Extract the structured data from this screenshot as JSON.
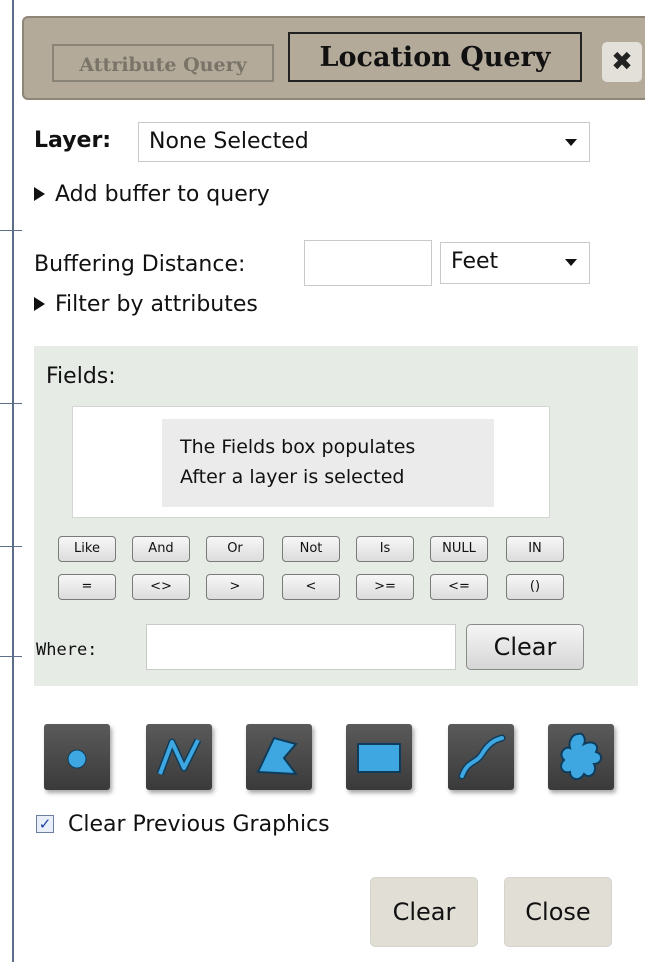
{
  "tabs": {
    "attribute_query": "Attribute Query",
    "location_query": "Location Query",
    "close_glyph": "✖"
  },
  "layer": {
    "label": "Layer:",
    "selected": "None Selected"
  },
  "buffer": {
    "toggle_label": "Add buffer to query",
    "distance_label": "Buffering Distance:",
    "distance_value": "",
    "unit_selected": "Feet"
  },
  "filter": {
    "toggle_label": "Filter by attributes",
    "fields_label": "Fields:",
    "fields_note_line1": "The Fields box populates",
    "fields_note_line2": "After a layer is selected",
    "operators_row1": [
      "Like",
      "And",
      "Or",
      "Not",
      "Is",
      "NULL",
      "IN"
    ],
    "operators_row2": [
      "=",
      "<>",
      ">",
      "<",
      ">=",
      "<=",
      "()"
    ],
    "where_label": "Where:",
    "where_value": "",
    "clear_label": "Clear"
  },
  "tools": {
    "icons": [
      "point-tool-icon",
      "polyline-tool-icon",
      "polygon-tool-icon",
      "rectangle-tool-icon",
      "freehand-line-tool-icon",
      "freehand-polygon-tool-icon"
    ],
    "tool_bg": "#4a4a4a",
    "tool_fill": "#3ea6e0"
  },
  "options": {
    "clear_previous_label": "Clear Previous Graphics",
    "clear_previous_checked": true
  },
  "footer": {
    "clear_label": "Clear",
    "close_label": "Close"
  },
  "colors": {
    "titlebar": "#b3aa9a",
    "filter_bg": "#e6ebe6",
    "footer_button": "#e1ded6"
  }
}
